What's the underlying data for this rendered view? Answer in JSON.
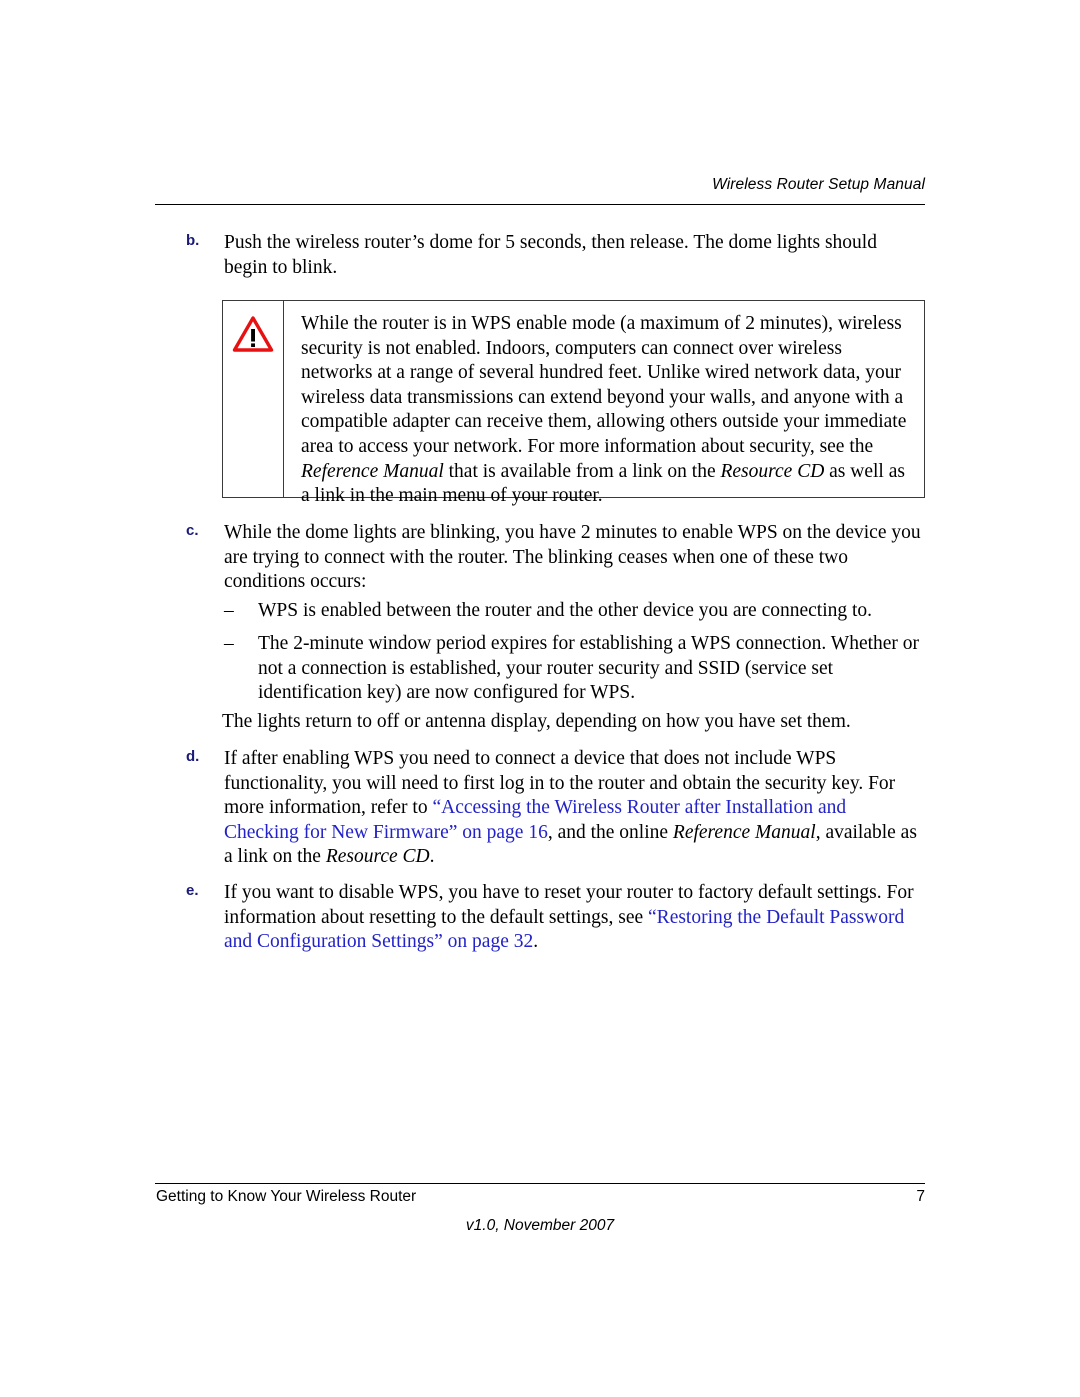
{
  "header": {
    "title": "Wireless Router Setup Manual"
  },
  "steps": {
    "b": {
      "marker": "b.",
      "text": "Push the wireless router’s dome for 5 seconds, then release. The dome lights should begin to blink."
    },
    "c": {
      "marker": "c.",
      "text": "While the dome lights are blinking, you have 2 minutes to enable WPS on the device you are trying to connect with the router. The blinking ceases when one of these two conditions occurs:"
    },
    "d": {
      "marker": "d.",
      "text_part1": "If after enabling WPS you need to connect a device that does not include WPS functionality, you will need to first log in to the router and obtain the security key. For more information, refer to ",
      "link": "“Accessing the Wireless Router after Installation and Checking for New Firmware” on page 16",
      "text_part2": ", and the online ",
      "italic1": "Reference Manual",
      "text_part3": ", available as a link on the ",
      "italic2": "Resource CD",
      "text_part4": "."
    },
    "e": {
      "marker": "e.",
      "text_part1": "If you want to disable WPS, you have to reset your router to factory default settings. For information about resetting to the default settings, see ",
      "link": "“Restoring the Default Password and Configuration Settings” on page 32",
      "text_part2": "."
    }
  },
  "bullets": [
    {
      "dash": "–",
      "text": "WPS is enabled between the router and the other device you are connecting to."
    },
    {
      "dash": "–",
      "text": "The 2-minute window period expires for establishing a WPS connection. Whether or not a connection is established, your router security and SSID (service set identification key) are now configured for WPS."
    }
  ],
  "closing_paragraph": "The lights return to off or antenna display, depending on how you have set them.",
  "notebox": {
    "icon": "warning-triangle-icon",
    "icon_outline_color": "#e81111",
    "text_part1": "While the router is in WPS enable mode (a maximum of 2 minutes), wireless security is not enabled. Indoors, computers can connect over wireless networks at a range of several hundred feet. Unlike wired network data, your wireless data transmissions can extend beyond your walls, and anyone with a compatible adapter can receive them, allowing others outside your immediate area to access your network. For more information about security, see the ",
    "italic1": "Reference Manual",
    "text_part2": " that is available from a link on the ",
    "italic2": "Resource CD",
    "text_part3": " as well as a link in the main menu of your router."
  },
  "footer": {
    "chapter": "Getting to Know Your Wireless Router",
    "page_number": "7",
    "version": "v1.0, November 2007"
  },
  "colors": {
    "link": "#2222c8",
    "marker": "#1a1a78",
    "warning": "#e81111",
    "text": "#000000"
  }
}
